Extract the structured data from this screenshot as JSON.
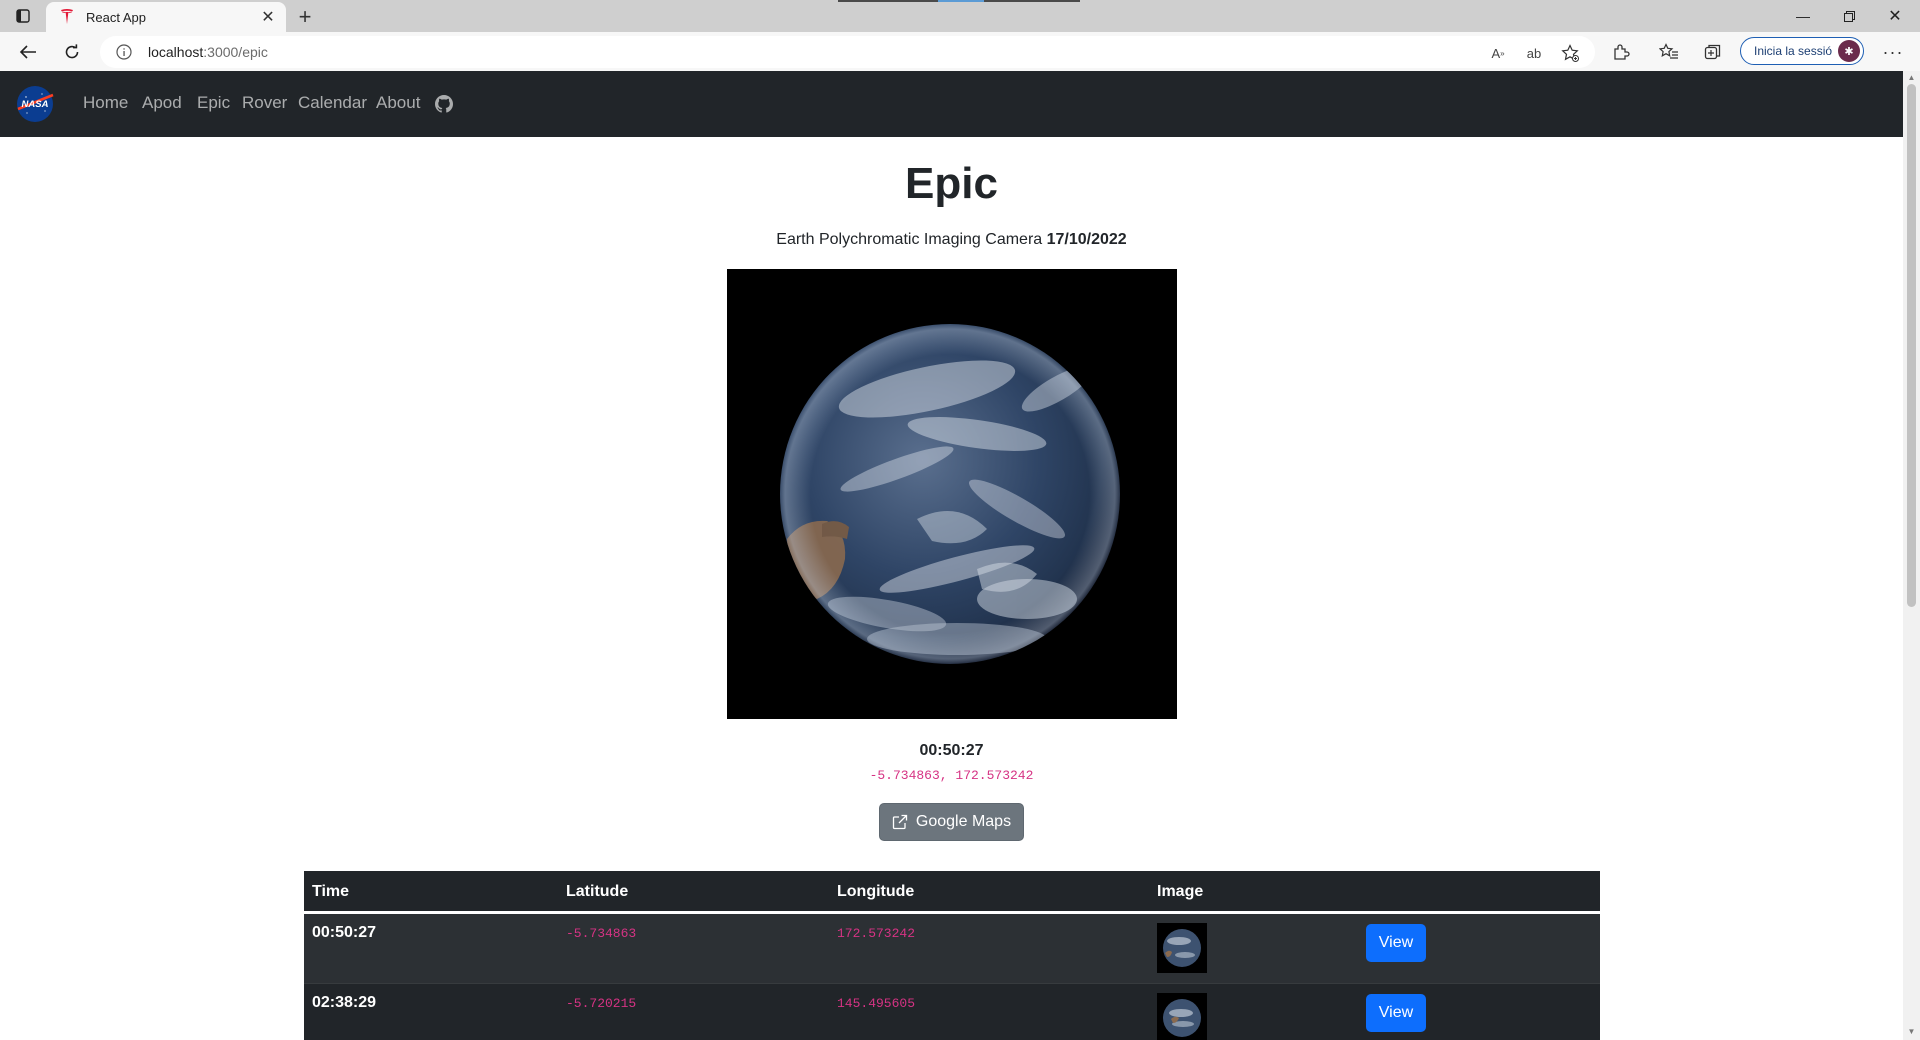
{
  "browser": {
    "tab_title": "React App",
    "url_host": "localhost",
    "url_rest": ":3000/epic",
    "signin_label": "Inicia la sessió"
  },
  "navbar": {
    "logo_text": "NASA",
    "links": [
      "Home",
      "Apod",
      "Epic",
      "Rover",
      "Calendar",
      "About"
    ]
  },
  "main": {
    "title": "Epic",
    "subtitle_prefix": "Earth Polychromatic Imaging Camera",
    "subtitle_date": "17/10/2022",
    "selected_time": "00:50:27",
    "selected_coords": "-5.734863, 172.573242",
    "maps_button": "Google Maps"
  },
  "table": {
    "headers": [
      "Time",
      "Latitude",
      "Longitude",
      "Image",
      ""
    ],
    "rows": [
      {
        "time": "00:50:27",
        "latitude": "-5.734863",
        "longitude": "172.573242",
        "action": "View"
      },
      {
        "time": "02:38:29",
        "latitude": "-5.720215",
        "longitude": "145.495605",
        "action": "View"
      }
    ]
  },
  "colors": {
    "navbar_bg": "#212529",
    "code_pink": "#d63384",
    "primary_blue": "#0d6efd",
    "secondary_gray": "#6c757d"
  },
  "icons": [
    "sidebar-toggle-icon",
    "tesla-favicon-icon",
    "close-icon",
    "plus-icon",
    "back-icon",
    "refresh-icon",
    "info-icon",
    "read-aloud-icon",
    "translate-icon",
    "favorite-add-icon",
    "extensions-icon",
    "favorites-icon",
    "collections-icon",
    "more-icon",
    "nasa-logo",
    "github-icon",
    "external-link-icon"
  ]
}
